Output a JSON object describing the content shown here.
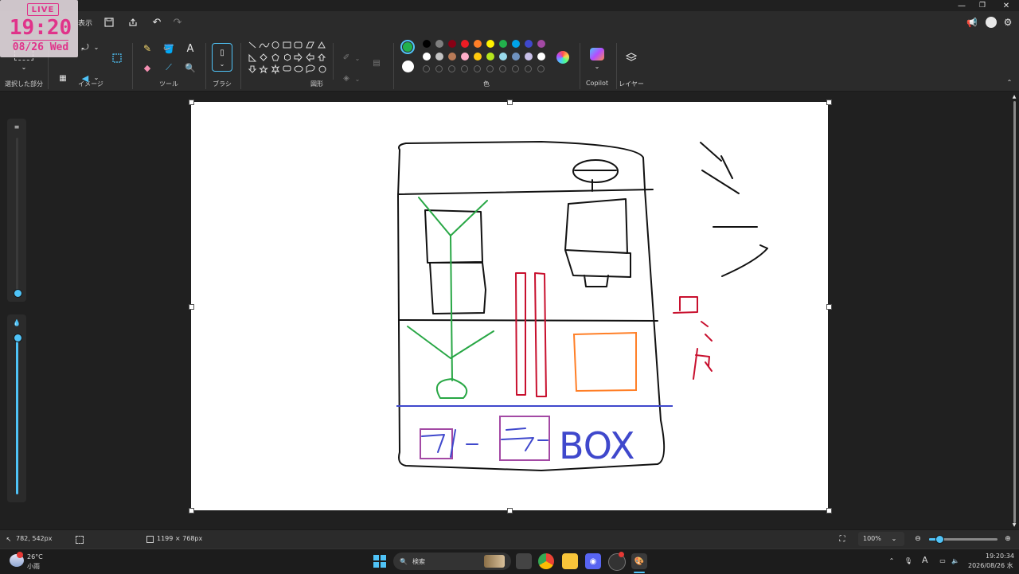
{
  "overlay": {
    "live": "LIVE",
    "time": "19:20",
    "date": "08/26 Wed"
  },
  "menu": {
    "view": "表示"
  },
  "ribbon": {
    "groups": {
      "selection": "選択した部分",
      "image": "イメージ",
      "tools": "ツール",
      "brush": "ブラシ",
      "shapes": "図形",
      "colors": "色",
      "copilot": "Copilot",
      "layers": "レイヤー"
    },
    "palette_row1": [
      "#000000",
      "#7f7f7f",
      "#880015",
      "#ed1c24",
      "#ff7f27",
      "#fff200",
      "#22b14c",
      "#00a2e8",
      "#3f48cc",
      "#a349a4"
    ],
    "palette_row2": [
      "#ffffff",
      "#c3c3c3",
      "#b97a57",
      "#ffaec9",
      "#ffc90e",
      "#b5e61d",
      "#99d9ea",
      "#7092be",
      "#c8bfe7",
      "#ffffff"
    ],
    "primary_color": "#22b14c",
    "secondary_color": "#ffffff"
  },
  "canvas": {
    "kana_shi": "シ",
    "kana_ro": "ロ",
    "kana_tsu": "ッ",
    "kana_do": "ド",
    "box_text": "BOX"
  },
  "status": {
    "cursor": "782, 542px",
    "size": "1199 × 768px",
    "zoom": "100%"
  },
  "taskbar": {
    "weather_temp": "26°C",
    "weather_desc": "小雨",
    "search_placeholder": "検索",
    "ime": "A",
    "clock_time": "19:20:34",
    "clock_date": "2026/08/26 水"
  }
}
